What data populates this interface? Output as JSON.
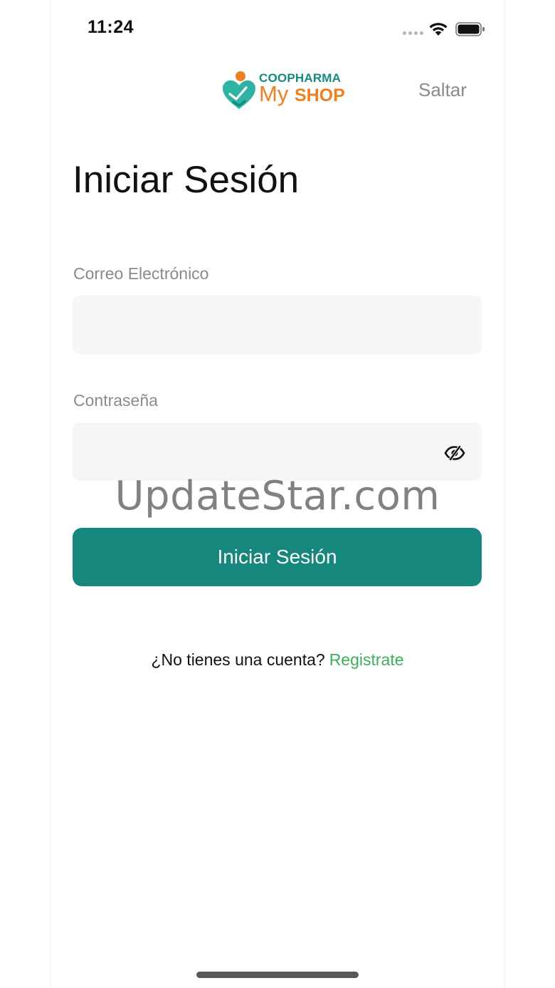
{
  "status_bar": {
    "time": "11:24"
  },
  "header": {
    "logo_top": "COOPHARMA",
    "logo_my": "My",
    "logo_shop": "SHOP",
    "skip_label": "Saltar"
  },
  "main": {
    "title": "Iniciar Sesión",
    "email_label": "Correo Electrónico",
    "email_value": "",
    "password_label": "Contraseña",
    "password_value": "",
    "login_label": "Iniciar Sesión",
    "no_account_text": "¿No tienes una cuenta?",
    "register_label": "Registrate"
  },
  "watermark": "UpdateStar.com",
  "colors": {
    "primary": "#15877d",
    "link": "#3fae5a",
    "logo_orange": "#ee7f22",
    "logo_teal": "#158a7e"
  },
  "icons": {
    "wifi": "wifi-icon",
    "battery": "battery-icon",
    "password_toggle": "eye-slash-icon"
  }
}
